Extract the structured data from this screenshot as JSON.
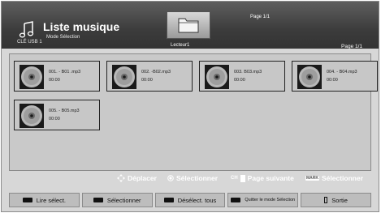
{
  "header": {
    "title": "Liste musique",
    "subtitle": "Mode Sélection",
    "source": "CLÉ USB 1",
    "folder_label": "Lecteur1",
    "page_indicator_top": "Page 1/1",
    "page_indicator_right": "Page 1/1"
  },
  "files": [
    {
      "name": "001. - B01 .mp3",
      "duration": "00:00"
    },
    {
      "name": "002. -B02.mp3",
      "duration": "00:00"
    },
    {
      "name": "003. B03.mp3",
      "duration": "00:00"
    },
    {
      "name": "004. - B04.mp3",
      "duration": "00:00"
    },
    {
      "name": "005. - B05.mp3",
      "duration": "00:00"
    }
  ],
  "hints": {
    "move": "Déplacer",
    "select": "Sélectionner",
    "ch_key": "CH",
    "next_page": "Page suivante",
    "mark_key": "MARK",
    "mark_select": "Sélectionner"
  },
  "footer": {
    "red": "Lire sélect.",
    "green": "Sélectionner",
    "yellow": "Désélect. tous",
    "blue": "Quitter le mode Sélection",
    "exit": "Sortie"
  }
}
